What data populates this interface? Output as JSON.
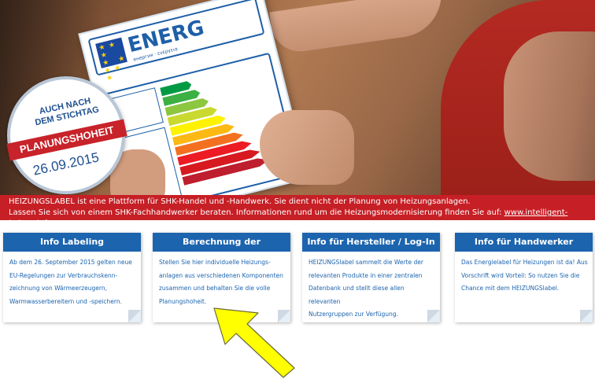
{
  "hero": {
    "label_title": "ENERG",
    "label_subtitle": "енергия · ενέργεια",
    "badge_line1": "AUCH NACH",
    "badge_line2": "DEM STICHTAG",
    "badge_ribbon": "PLANUNGSHOHEIT",
    "badge_date": "26.09.2015"
  },
  "band": {
    "line1": "HEIZUNGSLABEL ist eine Plattform für SHK-Handel und -Handwerk. Sie dient nicht der Planung von Heizungsanlagen.",
    "line2_prefix": "Lassen Sie sich von einem SHK-Fachhandwerker beraten. Informationen rund um die Heizungsmodernisierung finden Sie auf:",
    "link": "www.intelligent-heizen.info"
  },
  "cards": [
    {
      "title": "Info Labeling",
      "lines": [
        "Ab dem 26. September 2015 gelten neue",
        "EU-Regelungen zur Verbrauchskenn-",
        "zeichnung von Wärmeerzeugern,",
        "Warmwasserbereitern und -speichern."
      ]
    },
    {
      "title": "Berechnung der Verbundanlage",
      "lines": [
        "Stellen Sie hier individuelle Heizungs-",
        "anlagen aus verschiedenen Komponenten",
        "zusammen und behalten Sie die volle",
        "Planungshoheit."
      ]
    },
    {
      "title": "Info für Hersteller / Log-In",
      "lines": [
        "HEIZUNGSlabel sammelt die Werte der",
        "relevanten Produkte in einer zentralen",
        "Datenbank und stellt diese allen relevanten",
        "Nutzergruppen zur Verfügung."
      ]
    },
    {
      "title": "Info für Handwerker",
      "lines": [
        "Das Energielabel für Heizungen ist da! Aus",
        "Vorschrift wird Vorteil: So nutzen Sie die",
        "Chance mit dem HEIZUNGSlabel."
      ]
    }
  ],
  "colors": {
    "band_red": "#c61f25",
    "card_blue": "#1c64ae",
    "arrow_yellow": "#ffff00"
  }
}
